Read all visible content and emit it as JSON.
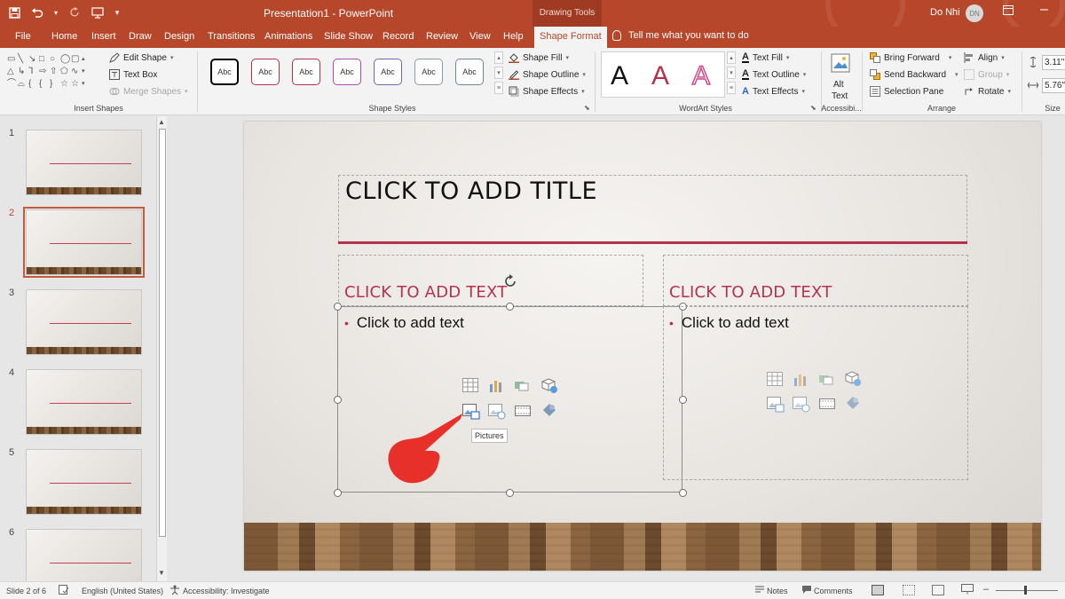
{
  "titlebar": {
    "doc_title": "Presentation1 - PowerPoint",
    "context": "Drawing Tools",
    "user_name": "Do Nhi",
    "user_initials": "DN"
  },
  "tabs": [
    "File",
    "Home",
    "Insert",
    "Draw",
    "Design",
    "Transitions",
    "Animations",
    "Slide Show",
    "Record",
    "Review",
    "View",
    "Help",
    "Shape Format"
  ],
  "active_tab": "Shape Format",
  "tell_me": "Tell me what you want to do",
  "ribbon": {
    "insert_shapes": {
      "label": "Insert Shapes",
      "edit_shape": "Edit Shape",
      "text_box": "Text Box",
      "merge_shapes": "Merge Shapes"
    },
    "shape_styles": {
      "label": "Shape Styles",
      "swatch_text": "Abc",
      "swatch_colors": [
        "#000000",
        "#b5324e",
        "#b5324e",
        "#b04ab0",
        "#6a6aa8",
        "#8a9aaa",
        "#6a8a8a"
      ],
      "fill": "Shape Fill",
      "outline": "Shape Outline",
      "effects": "Shape Effects"
    },
    "wordart": {
      "label": "WordArt Styles",
      "letter": "A",
      "text_fill": "Text Fill",
      "text_outline": "Text Outline",
      "text_effects": "Text Effects"
    },
    "accessibility": {
      "label": "Accessibi...",
      "alt_text_1": "Alt",
      "alt_text_2": "Text"
    },
    "arrange": {
      "label": "Arrange",
      "bring_forward": "Bring Forward",
      "send_backward": "Send Backward",
      "selection_pane": "Selection Pane",
      "align": "Align",
      "group": "Group",
      "rotate": "Rotate"
    },
    "size": {
      "label": "Size",
      "height": "3.11\"",
      "width": "5.76\""
    }
  },
  "thumbnails": [
    "1",
    "2",
    "3",
    "4",
    "5",
    "6"
  ],
  "selected_slide": "2",
  "slide": {
    "title": "CLICK TO ADD TITLE",
    "left_heading": "CLICK TO ADD TEXT",
    "left_bullet": "Click to add text",
    "right_heading": "CLICK TO ADD TEXT",
    "right_bullet": "Click to add text",
    "tooltip": "Pictures"
  },
  "status": {
    "slide_info": "Slide 2 of 6",
    "language": "English (United States)",
    "accessibility": "Accessibility: Investigate",
    "notes": "Notes",
    "comments": "Comments"
  },
  "colors": {
    "accent": "#b7472a",
    "title_rule": "#b5324e",
    "pointer": "#e8302a"
  },
  "icons": [
    "save-icon",
    "undo-icon",
    "redo-icon",
    "presenter-icon",
    "lightbulb-icon",
    "table-icon",
    "chart-icon",
    "smartart-icon",
    "3d-models-icon",
    "pictures-icon",
    "online-pictures-icon",
    "video-icon",
    "icons-icon",
    "pointing-hand-icon"
  ]
}
